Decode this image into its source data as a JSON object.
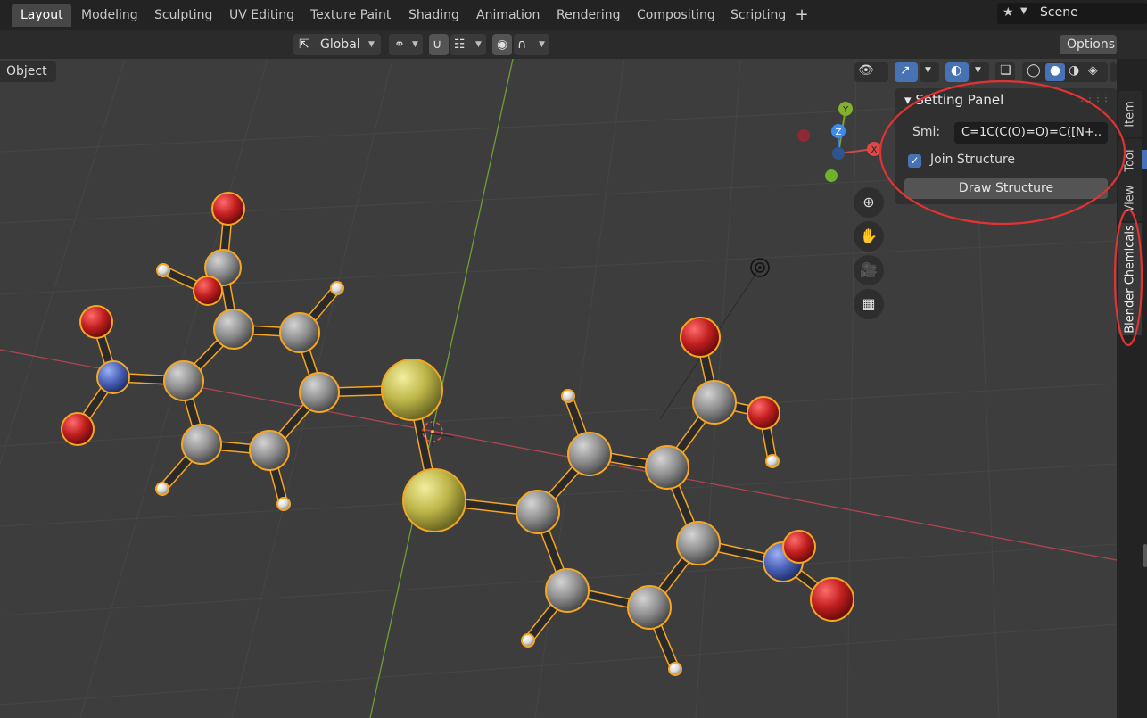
{
  "workspace_tabs": [
    "Layout",
    "Modeling",
    "Sculpting",
    "UV Editing",
    "Texture Paint",
    "Shading",
    "Animation",
    "Rendering",
    "Compositing",
    "Scripting"
  ],
  "active_tab": "Layout",
  "scene": {
    "name": "Scene"
  },
  "header": {
    "orientation": "Global",
    "options_label": "Options"
  },
  "mode_label": "Object",
  "panel": {
    "title": "Setting Panel",
    "smi_label": "Smi:",
    "smi_value": "C=1C(C(O)=O)=C([N+..",
    "join_label": "Join Structure",
    "join_checked": true,
    "draw_button": "Draw Structure"
  },
  "sidebar_tabs": [
    "Item",
    "Tool",
    "View",
    "Blender Chemicals"
  ],
  "gizmo": {
    "x": "X",
    "y": "Y",
    "z": "Z"
  },
  "colors": {
    "carbon": "#8a8a8a",
    "oxygen": "#c42222",
    "nitrogen": "#4a62b8",
    "sulfur": "#c9c253",
    "hydrogen": "#e4e4e4",
    "selection": "#f5a623",
    "annotation": "#e03333"
  },
  "icons": [
    "scene-icon",
    "transform-pivot-icon",
    "snap-icon",
    "proportional-edit-icon",
    "visibility-icon",
    "gizmo-icon",
    "overlay-icon",
    "xray-icon",
    "wireframe-icon",
    "solid-icon",
    "material-icon",
    "rendered-icon",
    "zoom-icon",
    "pan-hand-icon",
    "camera-icon",
    "grid-view-icon",
    "3d-cursor-icon"
  ]
}
